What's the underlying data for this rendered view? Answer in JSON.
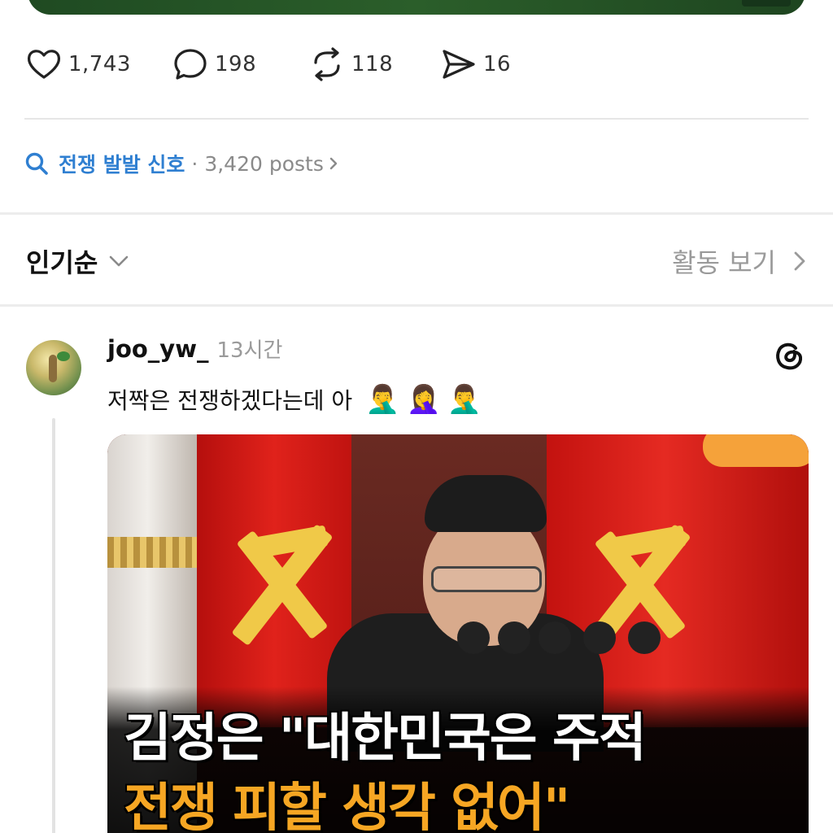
{
  "actions": {
    "like_count": "1,743",
    "comment_count": "198",
    "repost_count": "118",
    "share_count": "16"
  },
  "tag": {
    "label": "전쟁 발발 신호",
    "meta": "· 3,420 posts",
    "icon": "search-icon",
    "color": "#2f7fd1"
  },
  "sort": {
    "label": "인기순",
    "activity_label": "활동 보기"
  },
  "post": {
    "username": "joo_yw_",
    "time": "13시간",
    "text": "저짝은 전쟁하겠다는데 아",
    "emojis": [
      "🤦‍♂️",
      "🤦‍♀️",
      "🤦‍♂️"
    ],
    "image": {
      "caption_line1": "김정은 \"대한민국은 주적",
      "caption_line2": "전쟁 피할 생각 없어\"",
      "caption_color_1": "#ffffff",
      "caption_color_2": "#f6a623"
    }
  }
}
